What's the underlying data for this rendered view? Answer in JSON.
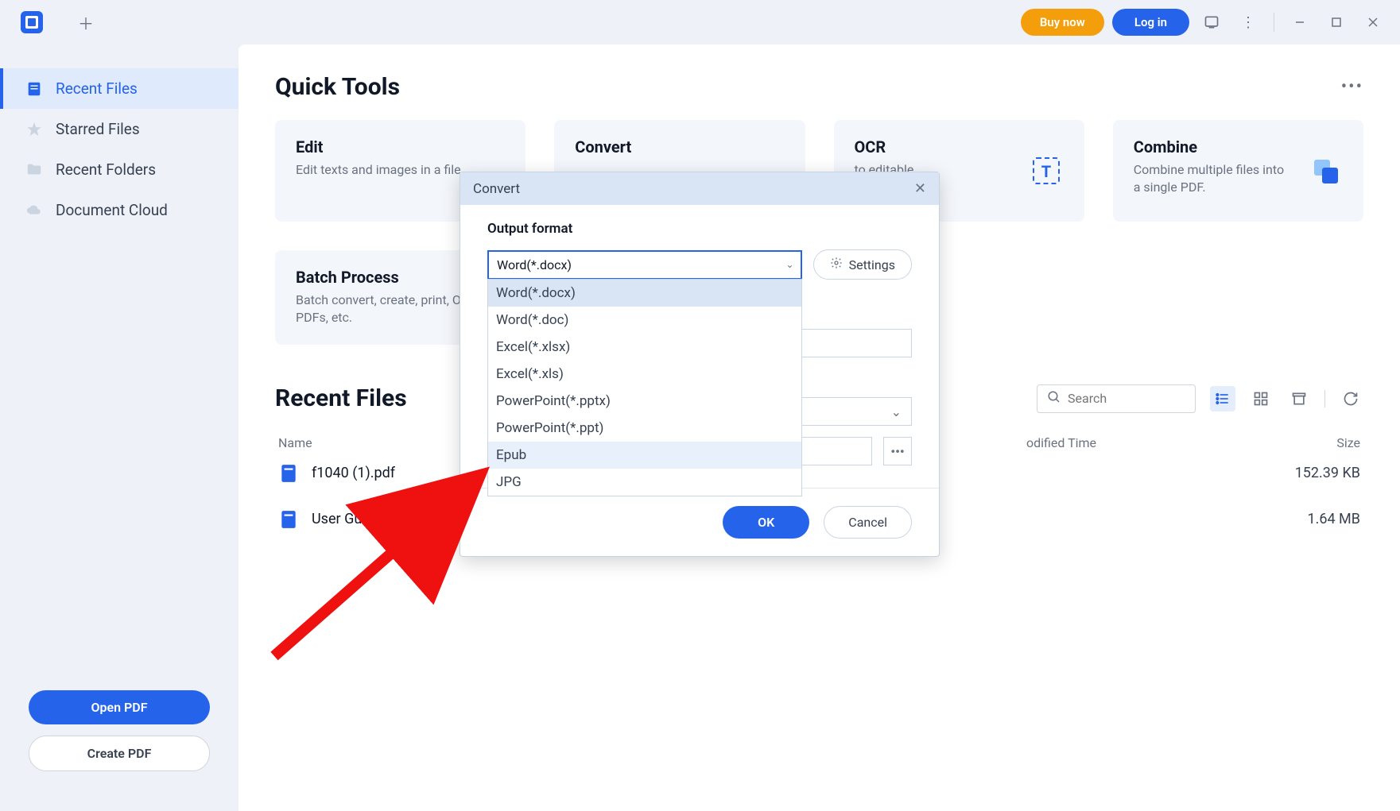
{
  "titlebar": {
    "buy_label": "Buy now",
    "login_label": "Log in"
  },
  "sidebar": {
    "items": [
      {
        "label": "Recent Files"
      },
      {
        "label": "Starred Files"
      },
      {
        "label": "Recent Folders"
      },
      {
        "label": "Document Cloud"
      }
    ],
    "open_label": "Open PDF",
    "create_label": "Create PDF"
  },
  "main": {
    "quick_tools_title": "Quick Tools",
    "tools": [
      {
        "title": "Edit",
        "desc": "Edit texts and images in a file."
      },
      {
        "title": "Convert",
        "desc": ""
      },
      {
        "title": "OCR",
        "desc": "to editable..."
      },
      {
        "title": "Combine",
        "desc": "Combine multiple files into a single PDF."
      }
    ],
    "batch": {
      "title": "Batch Process",
      "desc": "Batch convert, create, print, OCR PDFs, etc."
    },
    "recent_title": "Recent Files",
    "search_placeholder": "Search",
    "cols": {
      "name": "Name",
      "modified": "odified Time",
      "size": "Size"
    },
    "files": [
      {
        "name": "f1040 (1).pdf",
        "size": "152.39 KB"
      },
      {
        "name": "User Guide Book.pdf",
        "size": "1.64 MB"
      }
    ]
  },
  "dialog": {
    "title": "Convert",
    "output_label": "Output format",
    "selected": "Word(*.docx)",
    "settings_label": "Settings",
    "options": [
      "Word(*.docx)",
      "Word(*.doc)",
      "Excel(*.xlsx)",
      "Excel(*.xls)",
      "PowerPoint(*.pptx)",
      "PowerPoint(*.ppt)",
      "Epub",
      "JPG"
    ],
    "ok_label": "OK",
    "cancel_label": "Cancel"
  }
}
